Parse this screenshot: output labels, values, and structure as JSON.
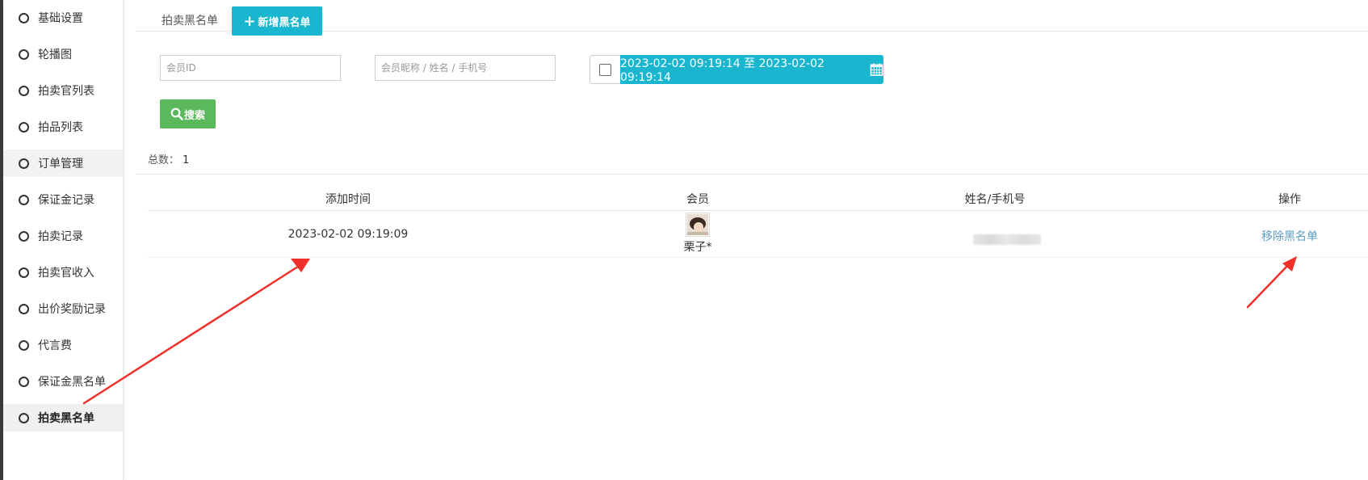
{
  "sidebar": {
    "items": [
      {
        "label": "基础设置"
      },
      {
        "label": "轮播图"
      },
      {
        "label": "拍卖官列表"
      },
      {
        "label": "拍品列表"
      },
      {
        "label": "订单管理"
      },
      {
        "label": "保证金记录"
      },
      {
        "label": "拍卖记录"
      },
      {
        "label": "拍卖官收入"
      },
      {
        "label": "出价奖励记录"
      },
      {
        "label": "代言费"
      },
      {
        "label": "保证金黑名单"
      },
      {
        "label": "拍卖黑名单"
      }
    ],
    "active_index": 11,
    "hover_index": 4
  },
  "tabs": {
    "current": "拍卖黑名单",
    "add_button": "新增黑名单"
  },
  "filters": {
    "member_id_placeholder": "会员ID",
    "member_search_placeholder": "会员昵称 / 姓名 / 手机号",
    "date_range": "2023-02-02 09:19:14 至 2023-02-02 09:19:14",
    "search_button": "搜索"
  },
  "total": {
    "label": "总数：",
    "count": "1"
  },
  "table": {
    "columns": [
      "添加时间",
      "会员",
      "姓名/手机号",
      "操作"
    ],
    "rows": [
      {
        "added_time": "2023-02-02 09:19:09",
        "member_name": "栗子*",
        "action": "移除黑名单"
      }
    ]
  },
  "colors": {
    "accent": "#1ab6d0",
    "search": "#5cb85c",
    "link": "#5b9bbf",
    "annotation_arrow": "#f0302a"
  }
}
